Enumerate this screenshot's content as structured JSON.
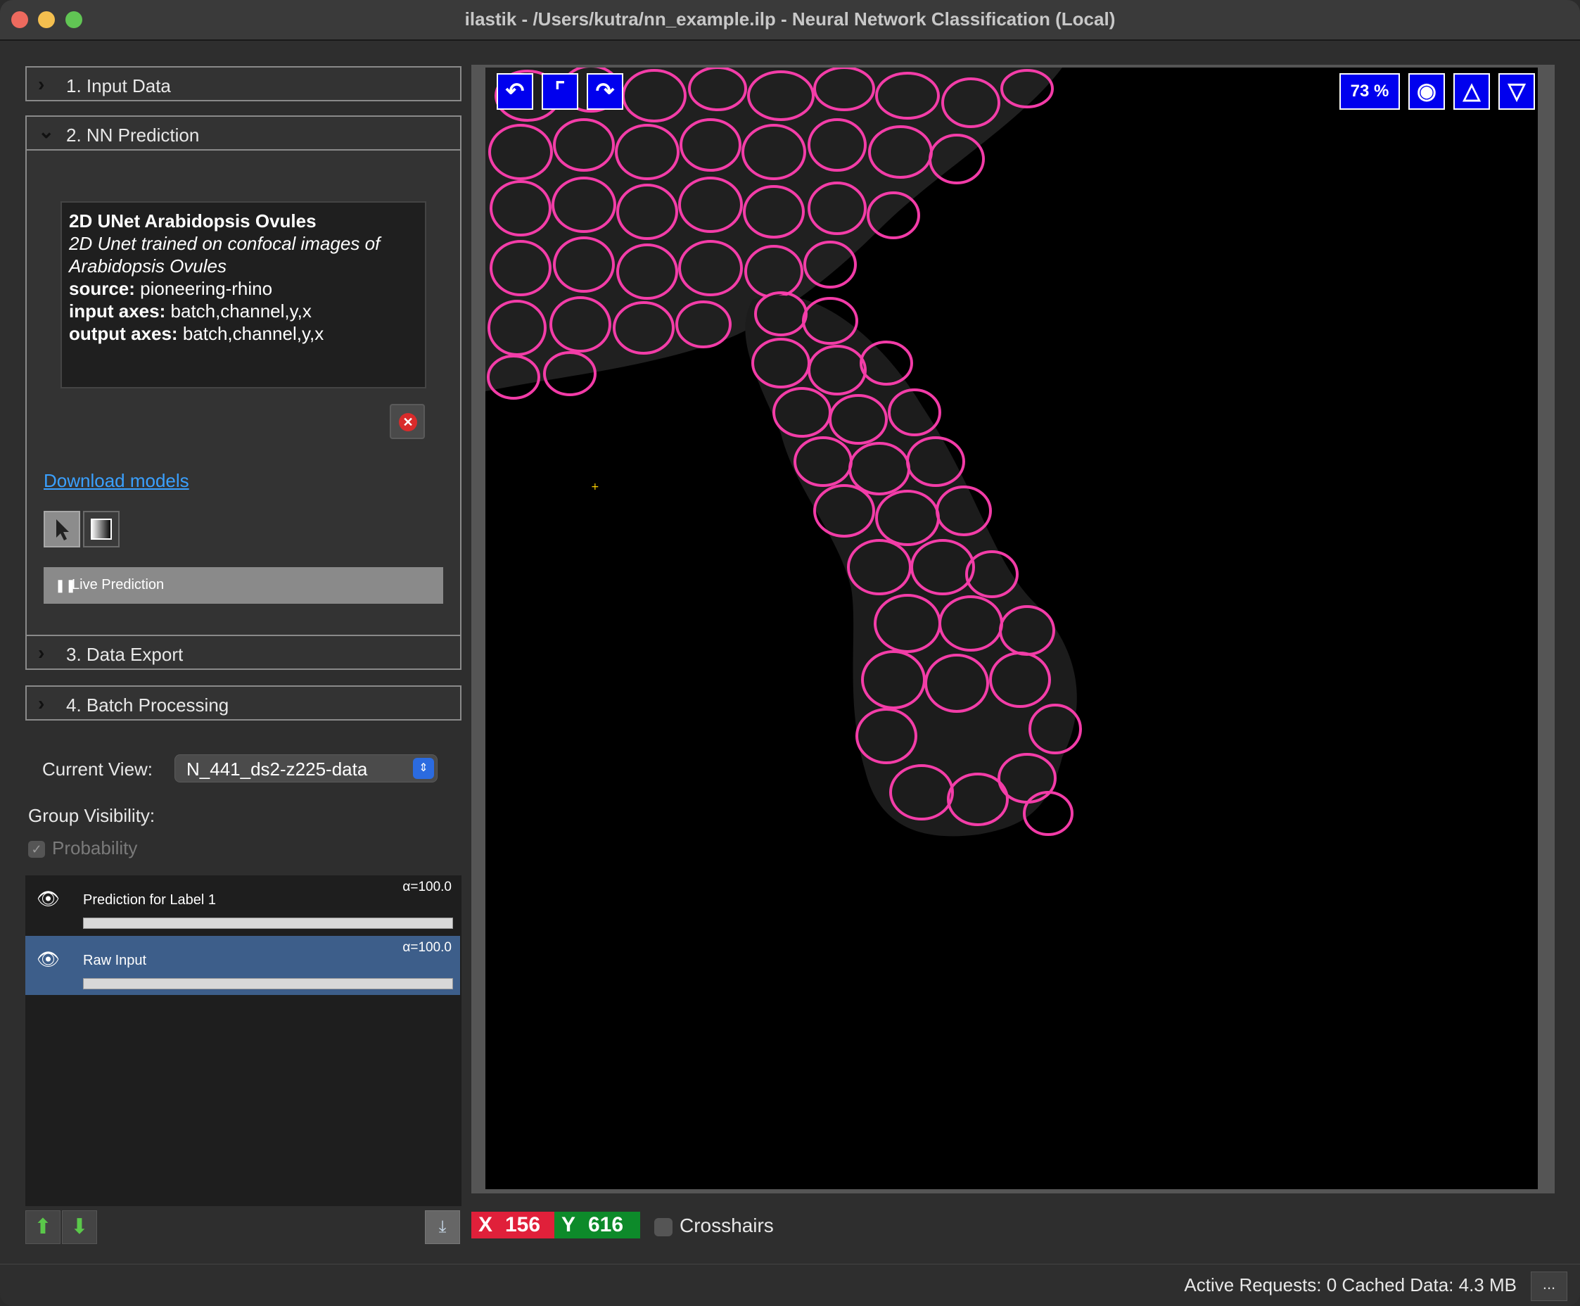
{
  "window": {
    "title": "ilastik - /Users/kutra/nn_example.ilp - Neural Network Classification (Local)"
  },
  "applets": [
    {
      "label": "1. Input Data"
    },
    {
      "label": "2. NN Prediction"
    },
    {
      "label": "3. Data Export"
    },
    {
      "label": "4. Batch Processing"
    }
  ],
  "model": {
    "name": "2D UNet Arabidopsis Ovules",
    "description": "2D Unet trained on confocal images of Arabidopsis Ovules",
    "source_label": "source:",
    "source": "pioneering-rhino",
    "input_axes_label": "input axes:",
    "input_axes": "batch,channel,y,x",
    "output_axes_label": "output axes:",
    "output_axes": "batch,channel,y,x"
  },
  "download_models": "Download models",
  "live_prediction": "Live Prediction",
  "current_view": {
    "label": "Current View:",
    "value": "N_441_ds2-z225-data"
  },
  "group_visibility": {
    "label": "Group Visibility:",
    "probability": "Probability"
  },
  "layers": [
    {
      "name": "Prediction for Label 1",
      "alpha": "α=100.0"
    },
    {
      "name": "Raw Input",
      "alpha": "α=100.0"
    }
  ],
  "viewer": {
    "zoom": "73 %"
  },
  "coords": {
    "x_label": "X",
    "x": "156",
    "y_label": "Y",
    "y": "616",
    "crosshairs": "Crosshairs"
  },
  "status": {
    "text": "Active Requests: 0  Cached Data: 4.3 MB",
    "more": "..."
  },
  "colors": {
    "accent_blue": "#0000ee",
    "cell_magenta": "#ff3fb0",
    "layer_selected": "#3d5e8a"
  }
}
